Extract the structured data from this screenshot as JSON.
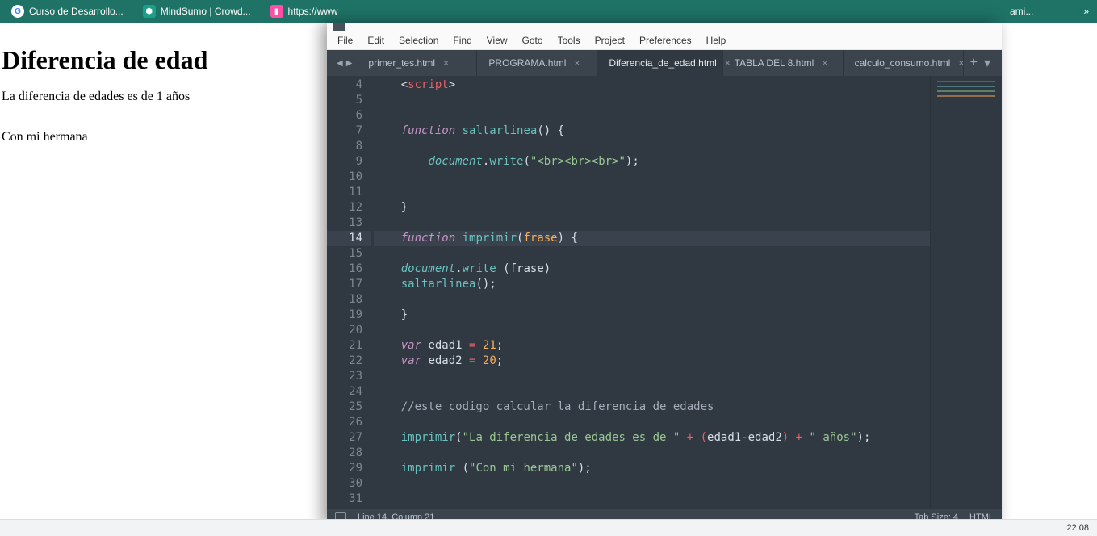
{
  "bookmarks": {
    "items": [
      {
        "label": "Curso de Desarrollo...",
        "iconClass": "g"
      },
      {
        "label": "MindSumo | Crowd...",
        "iconClass": "m"
      },
      {
        "label": "https://www",
        "iconClass": "p"
      }
    ],
    "overflowLabel": "ami...",
    "chevron": "»"
  },
  "page": {
    "title": "Diferencia de edad",
    "line1": "La diferencia de edades es de 1 años",
    "line2": "Con mi hermana"
  },
  "taskbar": {
    "clock": "22:08"
  },
  "sublime": {
    "titlebar": "",
    "menu": [
      "File",
      "Edit",
      "Selection",
      "Find",
      "View",
      "Goto",
      "Tools",
      "Project",
      "Preferences",
      "Help"
    ],
    "tabs": [
      {
        "label": "primer_tes.html",
        "active": false
      },
      {
        "label": "PROGRAMA.html",
        "active": false
      },
      {
        "label": "Diferencia_de_edad.html",
        "active": true
      },
      {
        "label": "TABLA DEL 8.html",
        "active": false
      },
      {
        "label": "calculo_consumo.html",
        "active": false
      }
    ],
    "firstLine": 4,
    "highlightLine": 14,
    "status": {
      "left": "Line 14, Column 21",
      "right1": "Tab Size: 4",
      "right2": "HTML"
    },
    "code": {
      "l4": {
        "a": "<",
        "b": "script",
        "c": ">"
      },
      "l7": {
        "a": "function",
        "b": "saltarlinea",
        "c": "() {"
      },
      "l9": {
        "a": "document",
        "b": ".",
        "c": "write",
        "d": "(",
        "e": "\"<br><br><br>\"",
        "f": ");"
      },
      "l12": {
        "a": "}"
      },
      "l14": {
        "a": "function",
        "b": "imprimir",
        "c": "(",
        "d": "frase",
        "e": ") {"
      },
      "l16": {
        "a": "document",
        "b": ".",
        "c": "write",
        "d": " (",
        "e": "frase",
        "f": ")"
      },
      "l17": {
        "a": "saltarlinea",
        "b": "();"
      },
      "l19": {
        "a": "}"
      },
      "l21": {
        "a": "var",
        "b": "edad1",
        "c": " = ",
        "d": "21",
        "e": ";"
      },
      "l22": {
        "a": "var",
        "b": "edad2",
        "c": " = ",
        "d": "20",
        "e": ";"
      },
      "l25": {
        "a": "//este codigo calcular la diferencia de edades"
      },
      "l27": {
        "a": "imprimir",
        "b": "(",
        "c": "\"La diferencia de edades es de \"",
        "d": " + (",
        "e": "edad1",
        "f": "-",
        "g": "edad2",
        "h": ") + ",
        "i": "\" años\"",
        "j": ");"
      },
      "l29": {
        "a": "imprimir",
        "b": " (",
        "c": "\"Con mi hermana\"",
        "d": ");"
      }
    }
  }
}
